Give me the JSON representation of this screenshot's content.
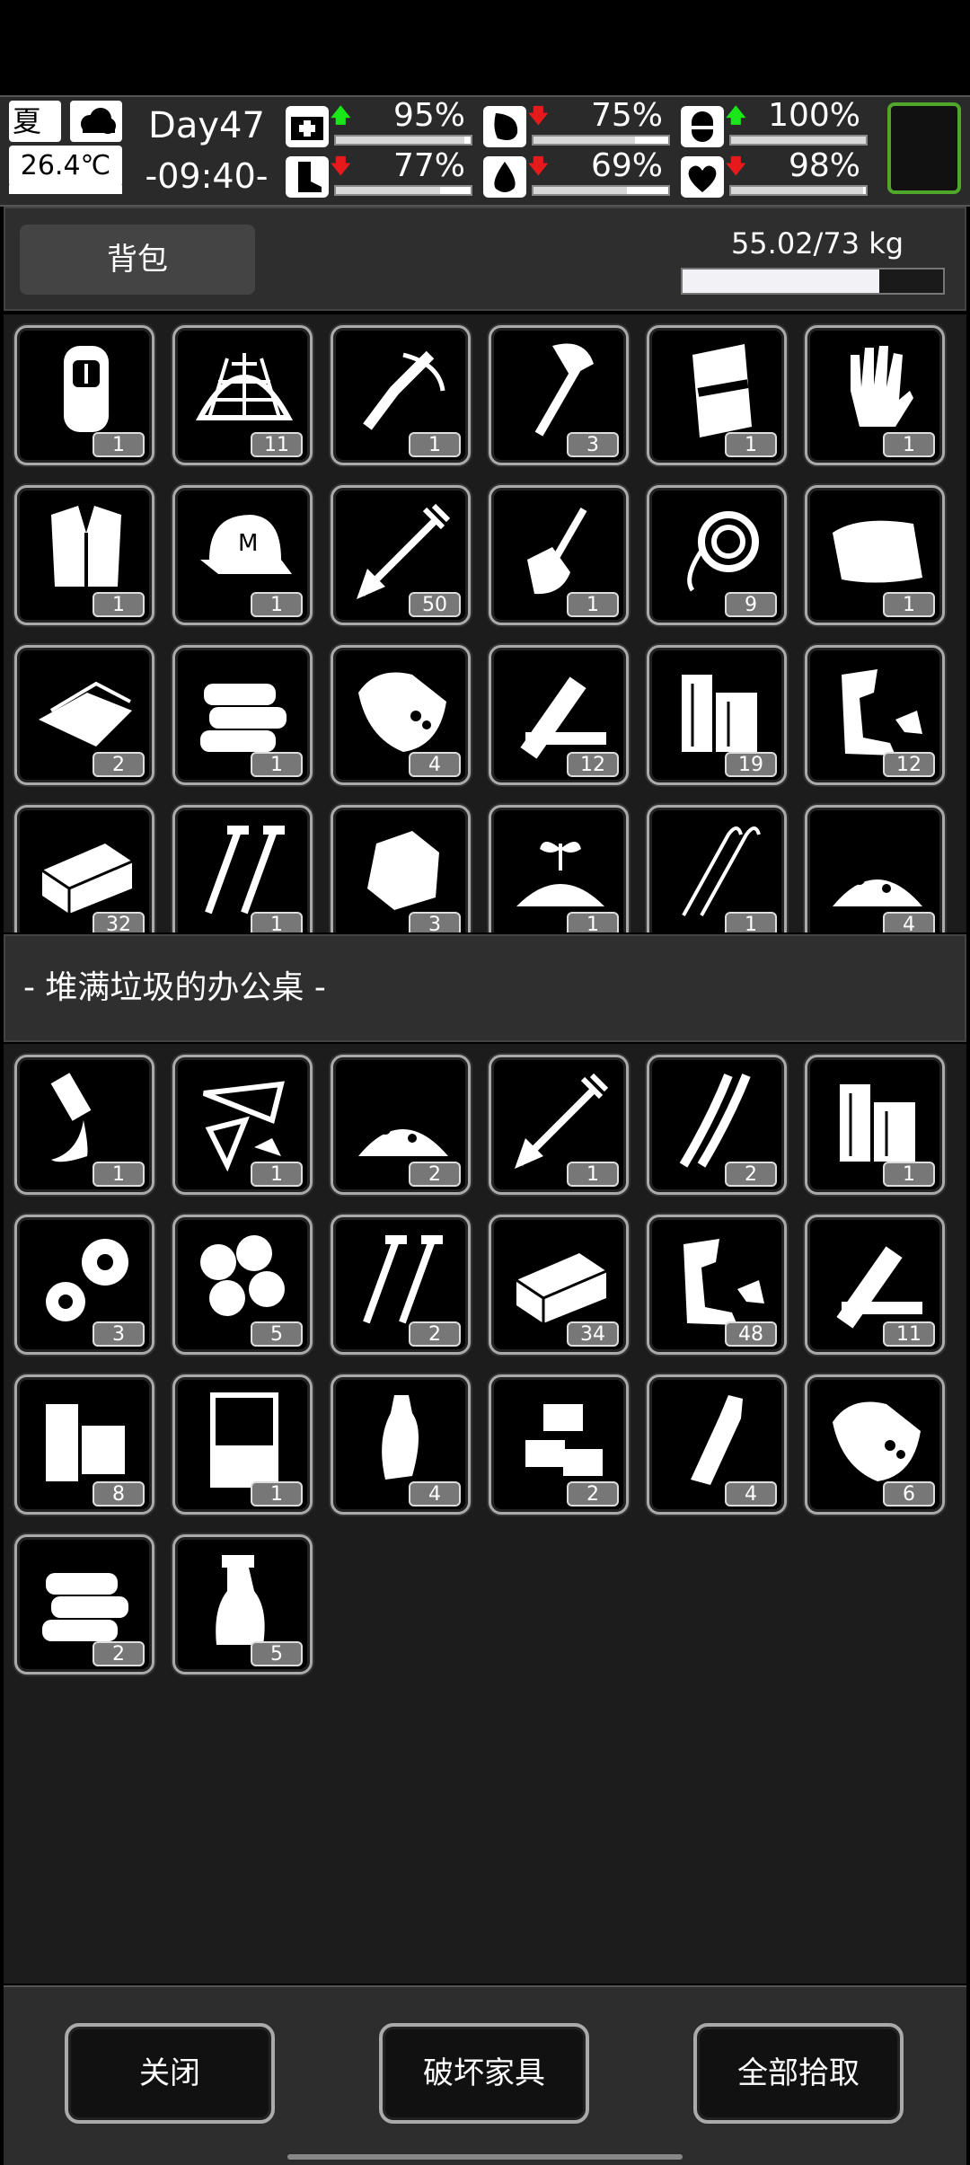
{
  "hud": {
    "season": "夏",
    "temperature": "26.4℃",
    "day": "Day47",
    "time": "-09:40-",
    "stats": [
      {
        "icon": "medkit-icon",
        "trend": "up",
        "value": "95%",
        "fill": 0.95
      },
      {
        "icon": "stomach-icon",
        "trend": "down",
        "value": "75%",
        "fill": 0.75
      },
      {
        "icon": "pill-icon",
        "trend": "up",
        "value": "100%",
        "fill": 1.0
      },
      {
        "icon": "boot-icon",
        "trend": "down",
        "value": "77%",
        "fill": 0.77
      },
      {
        "icon": "water-drop-icon",
        "trend": "down",
        "value": "69%",
        "fill": 0.69
      },
      {
        "icon": "heart-icon",
        "trend": "down",
        "value": "98%",
        "fill": 0.98
      }
    ],
    "arrow_up": "🡅",
    "arrow_down": "🡇"
  },
  "backpack": {
    "tab_label": "背包",
    "weight": "55.02/73 kg",
    "weight_fill": 0.754
  },
  "backpack_items": [
    {
      "icon": "backpack-icon",
      "count": "1"
    },
    {
      "icon": "net-icon",
      "count": "11"
    },
    {
      "icon": "crossbow-icon",
      "count": "1"
    },
    {
      "icon": "axe-icon",
      "count": "3"
    },
    {
      "icon": "riot-shield-icon",
      "count": "1"
    },
    {
      "icon": "glove-icon",
      "count": "1"
    },
    {
      "icon": "fur-vest-icon",
      "count": "1"
    },
    {
      "icon": "cap-icon",
      "count": "1"
    },
    {
      "icon": "arrow-icon",
      "count": "50"
    },
    {
      "icon": "shovel-icon",
      "count": "1"
    },
    {
      "icon": "rope-icon",
      "count": "9"
    },
    {
      "icon": "cloth-roll-icon",
      "count": "1"
    },
    {
      "icon": "paper-icon",
      "count": "2"
    },
    {
      "icon": "towel-stack-icon",
      "count": "1"
    },
    {
      "icon": "sack-icon",
      "count": "4"
    },
    {
      "icon": "planks-icon",
      "count": "12"
    },
    {
      "icon": "logs-icon",
      "count": "19"
    },
    {
      "icon": "scrap-metal-icon",
      "count": "12"
    },
    {
      "icon": "brick-icon",
      "count": "32"
    },
    {
      "icon": "screw-icon",
      "count": "1"
    },
    {
      "icon": "stone-icon",
      "count": "3"
    },
    {
      "icon": "sprout-icon",
      "count": "1"
    },
    {
      "icon": "wire-icon",
      "count": "1"
    },
    {
      "icon": "rubble-icon",
      "count": "4"
    }
  ],
  "container": {
    "title": "- 堆满垃圾的办公桌 -"
  },
  "container_items": [
    {
      "icon": "glue-icon",
      "count": "1"
    },
    {
      "icon": "glass-shards-icon",
      "count": "1"
    },
    {
      "icon": "rubble-icon",
      "count": "2"
    },
    {
      "icon": "arrow-icon",
      "count": "1"
    },
    {
      "icon": "cable-icon",
      "count": "2"
    },
    {
      "icon": "logs-icon",
      "count": "1"
    },
    {
      "icon": "gears-icon",
      "count": "3"
    },
    {
      "icon": "cotton-icon",
      "count": "5"
    },
    {
      "icon": "screw-icon",
      "count": "2"
    },
    {
      "icon": "brick-icon",
      "count": "34"
    },
    {
      "icon": "scrap-metal-icon",
      "count": "48"
    },
    {
      "icon": "planks-icon",
      "count": "11"
    },
    {
      "icon": "wood-blocks-icon",
      "count": "8"
    },
    {
      "icon": "beaker-icon",
      "count": "1"
    },
    {
      "icon": "plastic-bottle-icon",
      "count": "4"
    },
    {
      "icon": "blocks-icon",
      "count": "2"
    },
    {
      "icon": "bottle-icon",
      "count": "4"
    },
    {
      "icon": "sack-icon",
      "count": "6"
    },
    {
      "icon": "towel-stack-icon",
      "count": "2"
    },
    {
      "icon": "spray-bottle-icon",
      "count": "5"
    }
  ],
  "footer": {
    "close_label": "关闭",
    "destroy_label": "破坏家具",
    "take_all_label": "全部拾取"
  }
}
